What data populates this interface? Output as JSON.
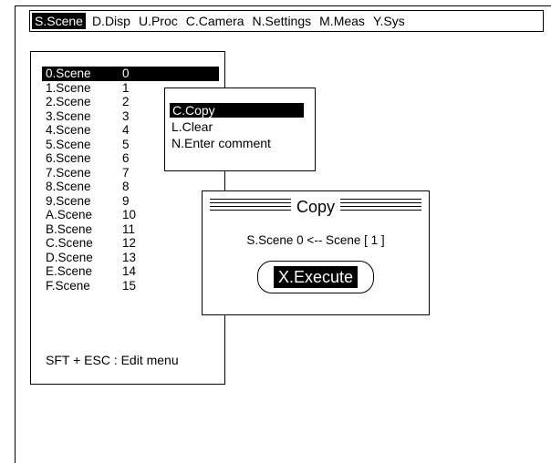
{
  "menu": [
    {
      "label": "S.Scene",
      "active": true
    },
    {
      "label": "D.Disp"
    },
    {
      "label": "U.Proc"
    },
    {
      "label": "C.Camera"
    },
    {
      "label": "N.Settings"
    },
    {
      "label": "M.Meas"
    },
    {
      "label": "Y.Sys"
    }
  ],
  "scenes": [
    {
      "name": "0.Scene",
      "num": "0"
    },
    {
      "name": "1.Scene",
      "num": "1"
    },
    {
      "name": "2.Scene",
      "num": "2"
    },
    {
      "name": "3.Scene",
      "num": "3"
    },
    {
      "name": "4.Scene",
      "num": "4"
    },
    {
      "name": "5.Scene",
      "num": "5"
    },
    {
      "name": "6.Scene",
      "num": "6"
    },
    {
      "name": "7.Scene",
      "num": "7"
    },
    {
      "name": "8.Scene",
      "num": "8"
    },
    {
      "name": "9.Scene",
      "num": "9"
    },
    {
      "name": "A.Scene",
      "num": "10"
    },
    {
      "name": "B.Scene",
      "num": "11"
    },
    {
      "name": "C.Scene",
      "num": "12"
    },
    {
      "name": "D.Scene",
      "num": "13"
    },
    {
      "name": "E.Scene",
      "num": "14"
    },
    {
      "name": "F.Scene",
      "num": "15"
    }
  ],
  "footer": "SFT + ESC : Edit menu",
  "popup": {
    "items": [
      "C.Copy",
      "L.Clear",
      "N.Enter comment"
    ]
  },
  "dialog": {
    "title": "Copy",
    "line": "S.Scene 0 <-- Scene  [  1 ]",
    "execute": "X.Execute"
  }
}
